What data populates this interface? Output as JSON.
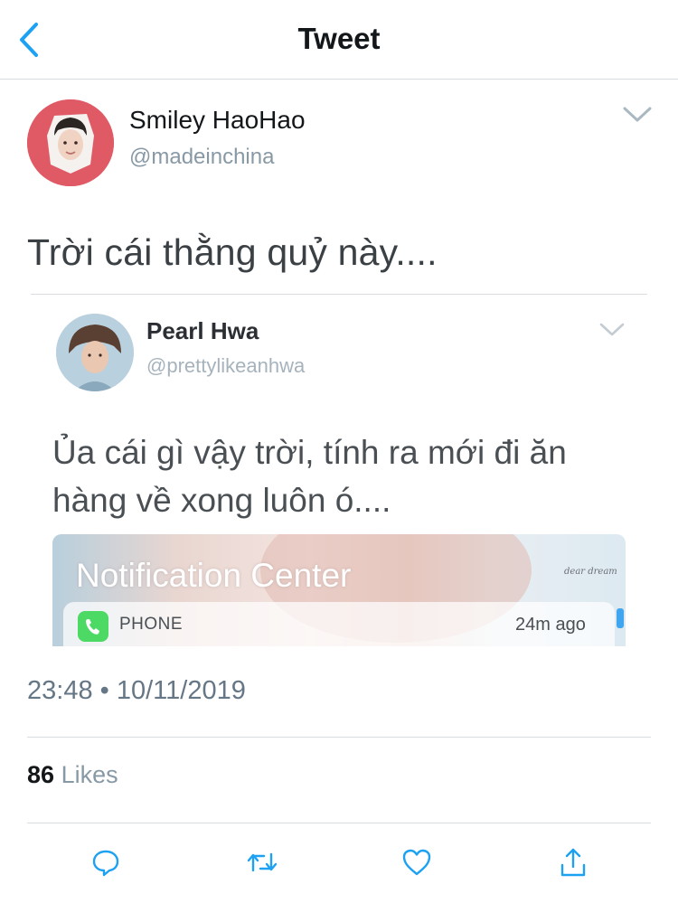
{
  "header": {
    "title": "Tweet",
    "back_icon": "chevron-left-icon"
  },
  "tweet": {
    "author_name": "Smiley HaoHao",
    "author_handle": "@madeinchina",
    "text": "Trời cái thằng quỷ này....",
    "timestamp": "23:48 • 10/11/2019",
    "likes_count": "86",
    "likes_label": "Likes"
  },
  "quoted_tweet": {
    "author_name": "Pearl Hwa",
    "author_handle": "@prettylikeanhwa",
    "text_line_1": "Ủa cái gì vậy trời, tính ra mới đi ăn",
    "text_line_2": "hàng về xong luôn ó....",
    "notification": {
      "title": "Notification Center",
      "app_label": "PHONE",
      "time": "24m ago",
      "logo_text": "dear dream"
    }
  },
  "actions": {
    "icons": [
      "reply-icon",
      "retweet-icon",
      "like-icon",
      "share-icon"
    ]
  },
  "colors": {
    "accent": "#1da1f2",
    "text_primary": "#14171a",
    "text_secondary": "#657786",
    "divider": "#d9dde1",
    "phone_green": "#4cd964"
  }
}
